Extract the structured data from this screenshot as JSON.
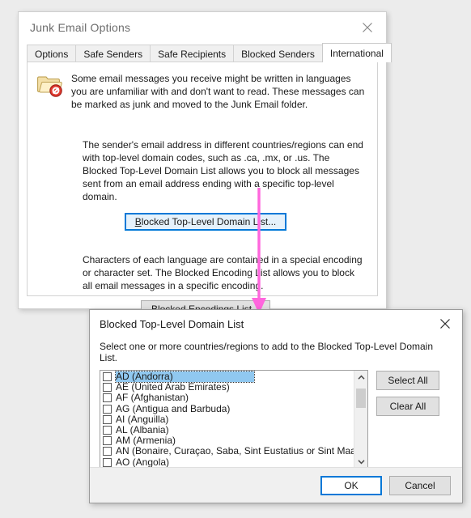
{
  "main_window": {
    "title": "Junk Email Options",
    "close_icon": "close-icon",
    "tabs": [
      {
        "label": "Options",
        "active": false
      },
      {
        "label": "Safe Senders",
        "active": false
      },
      {
        "label": "Safe Recipients",
        "active": false
      },
      {
        "label": "Blocked Senders",
        "active": false
      },
      {
        "label": "International",
        "active": true
      }
    ],
    "intro": {
      "icon": "blocked-folder-icon",
      "text": "Some email messages you receive might be written in languages you are unfamiliar with and don't want to read. These messages can be marked as junk and moved to the Junk Email folder."
    },
    "section_tld": {
      "paragraph": "The sender's email address in different countries/regions can end with top-level domain codes, such as .ca, .mx, or .us. The Blocked Top-Level Domain List allows you to block all messages sent from an email address ending with a specific top-level domain.",
      "button_accel": "B",
      "button_rest": "locked Top-Level Domain List..."
    },
    "section_encoding": {
      "paragraph": "Characters of each language are contained in a special encoding or character set. The Blocked Encoding List allows you to block all email messages in a specific encoding.",
      "button_accel": "B",
      "button_rest": "locked Encodings List..."
    }
  },
  "annotation": {
    "name": "arrow-pointer",
    "color": "#ff66dd",
    "direction": "down"
  },
  "tld_dialog": {
    "title": "Blocked Top-Level Domain List",
    "close_icon": "close-icon",
    "instruction": "Select one or more countries/regions to add to the Blocked Top-Level Domain List.",
    "list_items": [
      {
        "label": "AD (Andorra)",
        "checked": false,
        "selected": true
      },
      {
        "label": "AE (United Arab Emirates)",
        "checked": false,
        "selected": false
      },
      {
        "label": "AF (Afghanistan)",
        "checked": false,
        "selected": false
      },
      {
        "label": "AG (Antigua and Barbuda)",
        "checked": false,
        "selected": false
      },
      {
        "label": "AI (Anguilla)",
        "checked": false,
        "selected": false
      },
      {
        "label": "AL (Albania)",
        "checked": false,
        "selected": false
      },
      {
        "label": "AM (Armenia)",
        "checked": false,
        "selected": false
      },
      {
        "label": "AN (Bonaire, Curaçao, Saba, Sint Eustatius or Sint Maarten)",
        "checked": false,
        "selected": false
      },
      {
        "label": "AO (Angola)",
        "checked": false,
        "selected": false
      }
    ],
    "side_buttons": {
      "select_all": "Select All",
      "clear_all": "Clear All"
    },
    "footer_buttons": {
      "ok": "OK",
      "cancel": "Cancel"
    },
    "scrollbar": {
      "up_icon": "chevron-up-icon",
      "down_icon": "chevron-down-icon",
      "thumb": "scrollbar-thumb"
    }
  },
  "colors": {
    "accent": "#0078d7",
    "selection": "#90c8f0",
    "annotation": "#ff66dd",
    "desktop": "#ececec"
  }
}
